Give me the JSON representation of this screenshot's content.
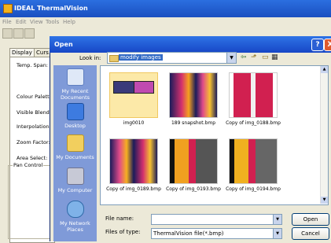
{
  "app": {
    "title": "IDEAL ThermalVision",
    "menu": [
      "File",
      "Edit",
      "View",
      "Tools",
      "Help"
    ],
    "tabs": [
      "Display",
      "Curs"
    ],
    "settings_labels": [
      "Temp. Span:",
      "Colour Palette",
      "Visible Blend:",
      "Interpolation:",
      "Zoom Factor:",
      "Area Select:"
    ],
    "pan_group_label": "Pan Control"
  },
  "dialog": {
    "title": "Open",
    "help": "?",
    "close": "X",
    "look_in_label": "Look in:",
    "look_in_value": "modify images",
    "places": [
      {
        "label": "My Recent Documents",
        "icon": "recent-documents-icon"
      },
      {
        "label": "Desktop",
        "icon": "desktop-icon"
      },
      {
        "label": "My Documents",
        "icon": "my-documents-icon"
      },
      {
        "label": "My Computer",
        "icon": "my-computer-icon"
      },
      {
        "label": "My Network Places",
        "icon": "network-places-icon"
      }
    ],
    "files": [
      {
        "name": "img0010",
        "kind": "folder"
      },
      {
        "name": "189 snapshot.bmp",
        "kind": "thermal-grid"
      },
      {
        "name": "Copy of img_0188.bmp",
        "kind": "thermal-red"
      },
      {
        "name": "Copy of img_0189.bmp",
        "kind": "thermal-grid"
      },
      {
        "name": "Copy of img_0193.bmp",
        "kind": "thermal-pipe"
      },
      {
        "name": "Copy of img_0194.bmp",
        "kind": "thermal-pipe"
      }
    ],
    "file_name_label": "File name:",
    "file_name_value": "",
    "files_of_type_label": "Files of type:",
    "files_of_type_value": "ThermalVision file(*.bmp)",
    "open_label": "Open",
    "cancel_label": "Cancel"
  }
}
